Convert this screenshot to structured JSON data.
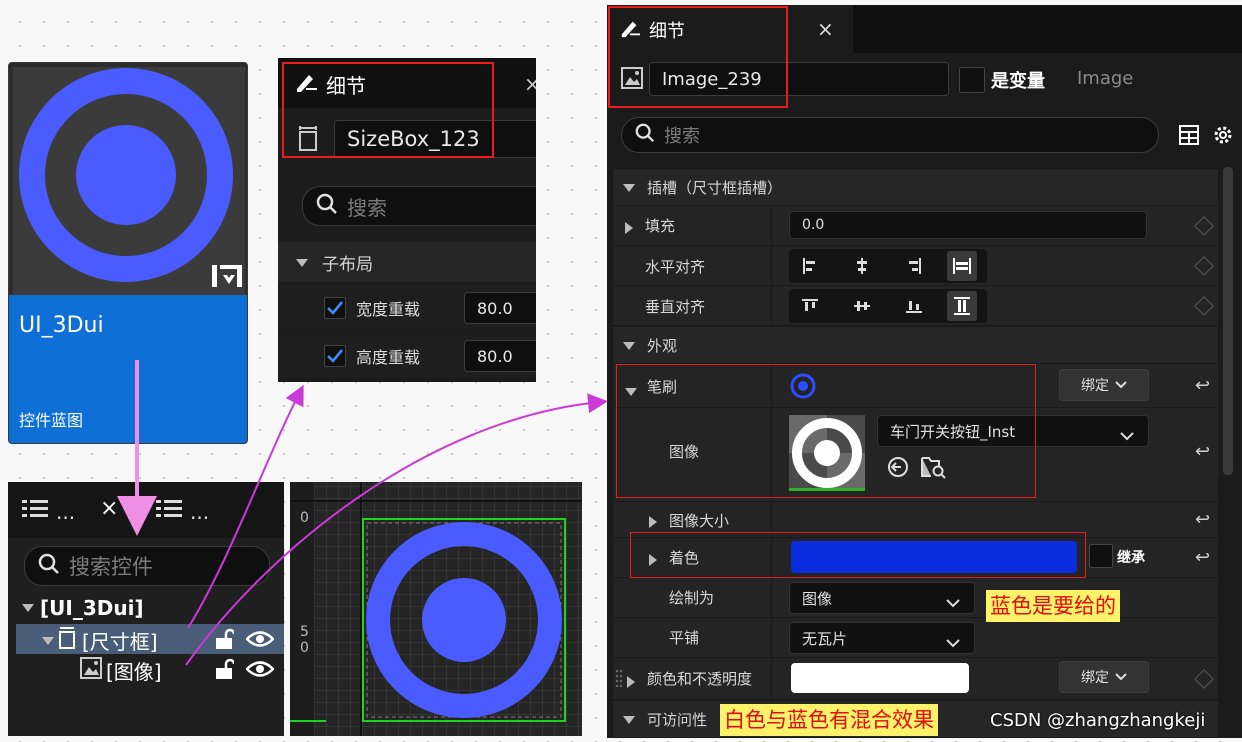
{
  "card": {
    "name": "UI_3Dui",
    "type": "控件蓝图",
    "accent": "#0e6fd6",
    "icon": "widget-blueprint-icon"
  },
  "small_details": {
    "tab_label": "细节",
    "close": "×",
    "object_name": "SizeBox_123",
    "search_placeholder": "搜索",
    "section": "子布局",
    "rows": [
      {
        "label": "宽度重载",
        "value": "80.0"
      },
      {
        "label": "高度重载",
        "value": "80.0"
      }
    ]
  },
  "hierarchy": {
    "tab1_dots": "...",
    "close": "×",
    "tab2_dots": "...",
    "search_placeholder": "搜索控件",
    "root": "[UI_3Dui]",
    "size_box": "[尺寸框]",
    "image": "[图像]"
  },
  "canvas": {
    "ruler_top": "0",
    "ruler_mid_a": "5",
    "ruler_mid_b": "0",
    "selection_color": "#1fd31f"
  },
  "details": {
    "tab_label": "细节",
    "close": "×",
    "object_name": "Image_239",
    "is_variable": "是变量",
    "class_name": "Image",
    "search_placeholder": "搜索",
    "slot_section": "插槽（尺寸框插槽）",
    "fill_label": "填充",
    "fill_value": "0.0",
    "halign_label": "水平对齐",
    "valign_label": "垂直对齐",
    "appearance_section": "外观",
    "brush_label": "笔刷",
    "bind_label": "绑定",
    "image_label": "图像",
    "image_asset": "车门开关按钮_Inst",
    "image_size_label": "图像大小",
    "tint_label": "着色",
    "tint_color": "#0a2de0",
    "inherit_label": "继承",
    "draw_as_label": "绘制为",
    "draw_as_value": "图像",
    "tiling_label": "平铺",
    "tiling_value": "无瓦片",
    "color_opacity_label": "颜色和不透明度",
    "color_opacity_value": "#ffffff",
    "bind_label2": "绑定",
    "accessibility_section": "可访问性"
  },
  "annotations": {
    "blue_note": "蓝色是要给的",
    "mix_note": "白色与蓝色有混合效果"
  },
  "watermark": "CSDN @zhangzhangkeji",
  "colors": {
    "ring_blue": "#4a5cff",
    "highlight_red": "#e81d1d",
    "arrow_magenta": "#c93ad6",
    "arrow_pink": "#ef8fe6",
    "note_yellow": "#fff26b"
  }
}
